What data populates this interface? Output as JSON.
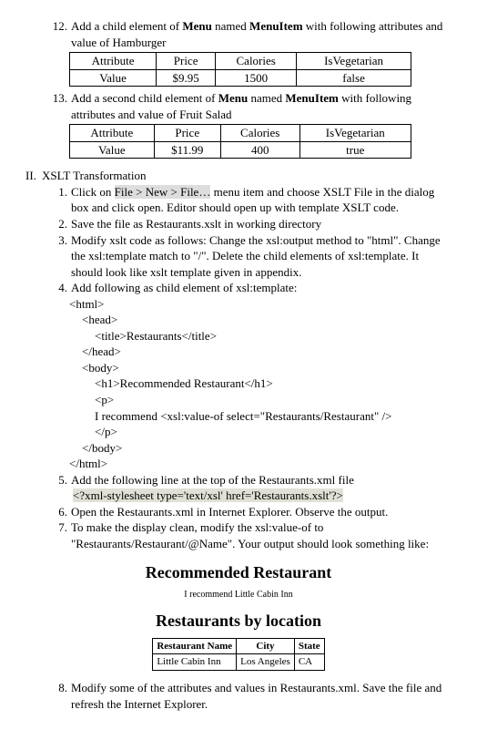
{
  "step12": {
    "num": "12.",
    "text_a": "Add a child element of ",
    "menu": "Menu",
    "text_b": " named ",
    "menuitem": "MenuItem",
    "text_c": " with following attributes and value of Hamburger"
  },
  "table1": {
    "h1": "Attribute",
    "h2": "Price",
    "h3": "Calories",
    "h4": "IsVegetarian",
    "r1": "Value",
    "r2": "$9.95",
    "r3": "1500",
    "r4": "false"
  },
  "step13": {
    "num": "13.",
    "text_a": "Add a second child element of ",
    "menu": "Menu",
    "text_b": " named ",
    "menuitem": "MenuItem",
    "text_c": " with following attributes and value of Fruit Salad"
  },
  "table2": {
    "h1": "Attribute",
    "h2": "Price",
    "h3": "Calories",
    "h4": "IsVegetarian",
    "r1": "Value",
    "r2": "$11.99",
    "r3": "400",
    "r4": "true"
  },
  "sectionII": {
    "num": "II.",
    "title": "XSLT Transformation"
  },
  "s1": {
    "num": "1.",
    "a": "Click on ",
    "hl": "File > New > File…",
    "b": " menu item and choose XSLT File in the dialog box and click open. Editor should open up with template XSLT code."
  },
  "s2": {
    "num": "2.",
    "t": "Save the file as Restaurants.xslt in working directory"
  },
  "s3": {
    "num": "3.",
    "t": "Modify xslt code as follows: Change the xsl:output method to \"html\". Change the xsl:template match to \"/\". Delete the child elements of xsl:template. It should look like xslt template given in appendix."
  },
  "s4": {
    "num": "4.",
    "t": "Add following as child element of xsl:template:"
  },
  "code": {
    "l1": "<html>",
    "l2": "<head>",
    "l3": "<title>Restaurants</title>",
    "l4": "</head>",
    "l5": "<body>",
    "l6": "<h1>Recommended Restaurant</h1>",
    "l7": "<p>",
    "l8": "I recommend <xsl:value-of select=\"Restaurants/Restaurant\" />",
    "l9": "</p>",
    "l10": "</body>",
    "l11": "</html>"
  },
  "s5": {
    "num": "5.",
    "t": "Add the following line at the top of the Restaurants.xml file"
  },
  "s5code": "<?xml-stylesheet type='text/xsl' href='Restaurants.xslt'?>",
  "s6": {
    "num": "6.",
    "t": "Open the Restaurants.xml in Internet Explorer. Observe the output."
  },
  "s7": {
    "num": "7.",
    "t": "To make the display clean, modify the xsl:value-of to \"Restaurants/Restaurant/@Name\". Your output should look something like:"
  },
  "output": {
    "h1": "Recommended Restaurant",
    "line": "I recommend Little Cabin Inn",
    "h2": "Restaurants by location",
    "th1": "Restaurant Name",
    "th2": "City",
    "th3": "State",
    "td1": "Little Cabin Inn",
    "td2": "Los Angeles",
    "td3": "CA"
  },
  "s8": {
    "num": "8.",
    "t": "Modify some of the attributes and values in Restaurants.xml. Save the file and refresh the Internet Explorer."
  }
}
